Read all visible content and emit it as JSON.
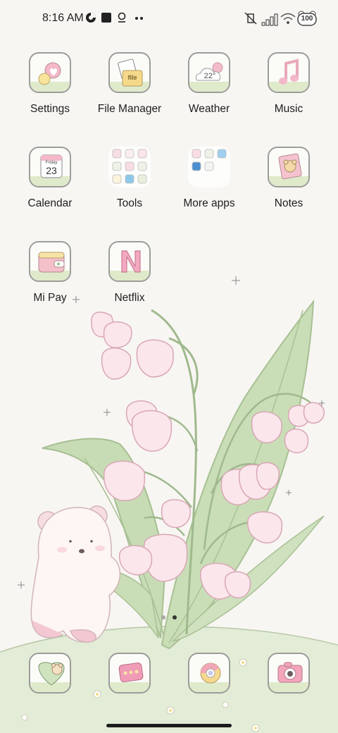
{
  "status_bar": {
    "time": "8:16 AM",
    "battery": "100"
  },
  "apps": [
    {
      "label": "Settings",
      "icon": "settings-gear-heart-icon"
    },
    {
      "label": "File Manager",
      "icon": "file-folder-icon"
    },
    {
      "label": "Weather",
      "icon": "weather-cloud-icon",
      "badge": "22°"
    },
    {
      "label": "Music",
      "icon": "music-note-icon"
    },
    {
      "label": "Calendar",
      "icon": "calendar-icon",
      "weekday": "Friday",
      "day": "23"
    },
    {
      "label": "Tools",
      "icon": "tools-folder-icon"
    },
    {
      "label": "More apps",
      "icon": "more-apps-folder-icon"
    },
    {
      "label": "Notes",
      "icon": "notes-bear-icon"
    },
    {
      "label": "Mi Pay",
      "icon": "wallet-icon"
    },
    {
      "label": "Netflix",
      "icon": "netflix-n-icon"
    }
  ],
  "file_manager_badge": "file",
  "dock": [
    {
      "icon": "phone-bear-icon"
    },
    {
      "icon": "messages-icon"
    },
    {
      "icon": "chrome-icon"
    },
    {
      "icon": "camera-icon"
    }
  ],
  "colors": {
    "background": "#f8f6f2",
    "pink": "#f2b8c6",
    "leaf_green": "#bfd7b0",
    "grass": "#dde9cf"
  }
}
